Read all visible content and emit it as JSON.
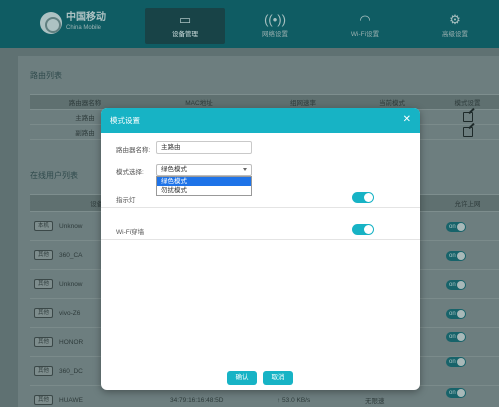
{
  "brand": {
    "name_cn": "中国移动",
    "name_en": "China Mobile"
  },
  "nav": [
    {
      "label": "设备管理",
      "icon": "router-icon"
    },
    {
      "label": "网络设置",
      "icon": "broadcast-icon"
    },
    {
      "label": "Wi-Fi设置",
      "icon": "wifi-icon"
    },
    {
      "label": "高级设置",
      "icon": "gear-icon"
    }
  ],
  "router_list": {
    "title": "路由列表",
    "columns": [
      "路由器名称",
      "MAC地址",
      "组网速率",
      "当前模式",
      "模式设置"
    ],
    "rows": [
      {
        "name": "主路由"
      },
      {
        "name": "副路由"
      }
    ]
  },
  "online_users": {
    "title": "在线用户列表",
    "columns": [
      "设备名",
      "允许上网"
    ],
    "rows": [
      {
        "badge": "本机",
        "name": "Unknow",
        "toggle": "on"
      },
      {
        "badge": "其他",
        "name": "360_CA",
        "toggle": "on"
      },
      {
        "badge": "其他",
        "name": "Unknow",
        "toggle": "on"
      },
      {
        "badge": "其他",
        "name": "vivo-Z6",
        "toggle": "on"
      },
      {
        "badge": "其他",
        "name": "HONOR",
        "toggle": "on"
      },
      {
        "badge": "其他",
        "name": "360_DC",
        "toggle": "on"
      },
      {
        "badge": "其他",
        "name": "HUAWE",
        "toggle": "on"
      }
    ],
    "last_row_extra": {
      "mac": "34:79:16:16:48:5D",
      "speed": "↑ 53.0 KB/s",
      "limit": "无限速"
    }
  },
  "modal": {
    "title": "模式设置",
    "router_name_label": "路由器名称:",
    "router_name_value": "主路由",
    "mode_label": "模式选择:",
    "mode_selected": "绿色模式",
    "mode_options": [
      "绿色模式",
      "勿扰模式"
    ],
    "indicator_label": "指示灯",
    "wall_label": "Wi-Fi穿墙",
    "confirm_label": "确认",
    "cancel_label": "取消"
  },
  "colors": {
    "accent": "#17b3c5",
    "header": "#0f5c63",
    "dropdown_highlight": "#1e73e8"
  }
}
